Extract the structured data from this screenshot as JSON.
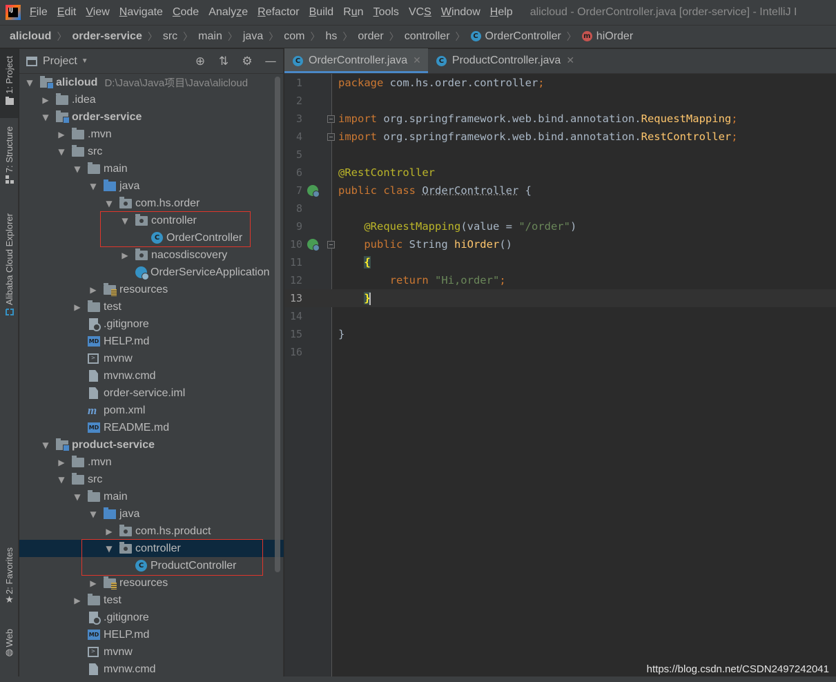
{
  "window": {
    "title": "alicloud - OrderController.java [order-service] - IntelliJ I"
  },
  "menu": [
    {
      "pre": "",
      "ul": "F",
      "post": "ile"
    },
    {
      "pre": "",
      "ul": "E",
      "post": "dit"
    },
    {
      "pre": "",
      "ul": "V",
      "post": "iew"
    },
    {
      "pre": "",
      "ul": "N",
      "post": "avigate"
    },
    {
      "pre": "",
      "ul": "C",
      "post": "ode"
    },
    {
      "pre": "Analy",
      "ul": "z",
      "post": "e"
    },
    {
      "pre": "",
      "ul": "R",
      "post": "efactor"
    },
    {
      "pre": "",
      "ul": "B",
      "post": "uild"
    },
    {
      "pre": "R",
      "ul": "u",
      "post": "n"
    },
    {
      "pre": "",
      "ul": "T",
      "post": "ools"
    },
    {
      "pre": "VC",
      "ul": "S",
      "post": ""
    },
    {
      "pre": "",
      "ul": "W",
      "post": "indow"
    },
    {
      "pre": "",
      "ul": "H",
      "post": "elp"
    }
  ],
  "breadcrumb": {
    "items": [
      "alicloud",
      "order-service",
      "src",
      "main",
      "java",
      "com",
      "hs",
      "order",
      "controller"
    ],
    "class_label": "OrderController",
    "method_label": "hiOrder"
  },
  "toolstrip": {
    "project": "1: Project",
    "structure": "7: Structure",
    "cloud": "Alibaba Cloud Explorer",
    "favorites": "2: Favorites",
    "web": "Web"
  },
  "project_panel": {
    "title": "Project"
  },
  "tree": [
    {
      "label": "alicloud",
      "path": "D:\\Java\\Java项目\\Java\\alicloud",
      "depth": 0,
      "arrow": "down",
      "icon": "module",
      "bold": true
    },
    {
      "label": ".idea",
      "depth": 1,
      "arrow": "right",
      "icon": "folder"
    },
    {
      "label": "order-service",
      "depth": 1,
      "arrow": "down",
      "icon": "module",
      "bold": true
    },
    {
      "label": ".mvn",
      "depth": 2,
      "arrow": "right",
      "icon": "folder"
    },
    {
      "label": "src",
      "depth": 2,
      "arrow": "down",
      "icon": "folder"
    },
    {
      "label": "main",
      "depth": 3,
      "arrow": "down",
      "icon": "folder"
    },
    {
      "label": "java",
      "depth": 4,
      "arrow": "down",
      "icon": "folder-blue"
    },
    {
      "label": "com.hs.order",
      "depth": 5,
      "arrow": "down",
      "icon": "package"
    },
    {
      "label": "controller",
      "depth": 6,
      "arrow": "down",
      "icon": "package"
    },
    {
      "label": "OrderController",
      "depth": 7,
      "arrow": "none",
      "icon": "class"
    },
    {
      "label": "nacosdiscovery",
      "depth": 6,
      "arrow": "right",
      "icon": "package"
    },
    {
      "label": "OrderServiceApplication",
      "depth": 6,
      "arrow": "none",
      "icon": "appclass"
    },
    {
      "label": "resources",
      "depth": 4,
      "arrow": "right",
      "icon": "resources"
    },
    {
      "label": "test",
      "depth": 3,
      "arrow": "right",
      "icon": "folder"
    },
    {
      "label": ".gitignore",
      "depth": 3,
      "arrow": "none",
      "icon": "git"
    },
    {
      "label": "HELP.md",
      "depth": 3,
      "arrow": "none",
      "icon": "md"
    },
    {
      "label": "mvnw",
      "depth": 3,
      "arrow": "none",
      "icon": "term"
    },
    {
      "label": "mvnw.cmd",
      "depth": 3,
      "arrow": "none",
      "icon": "file"
    },
    {
      "label": "order-service.iml",
      "depth": 3,
      "arrow": "none",
      "icon": "file"
    },
    {
      "label": "pom.xml",
      "depth": 3,
      "arrow": "none",
      "icon": "maven"
    },
    {
      "label": "README.md",
      "depth": 3,
      "arrow": "none",
      "icon": "md"
    },
    {
      "label": "product-service",
      "depth": 1,
      "arrow": "down",
      "icon": "module",
      "bold": true
    },
    {
      "label": ".mvn",
      "depth": 2,
      "arrow": "right",
      "icon": "folder"
    },
    {
      "label": "src",
      "depth": 2,
      "arrow": "down",
      "icon": "folder"
    },
    {
      "label": "main",
      "depth": 3,
      "arrow": "down",
      "icon": "folder"
    },
    {
      "label": "java",
      "depth": 4,
      "arrow": "down",
      "icon": "folder-blue"
    },
    {
      "label": "com.hs.product",
      "depth": 5,
      "arrow": "right",
      "icon": "package"
    },
    {
      "label": "controller",
      "depth": 5,
      "arrow": "down",
      "icon": "package",
      "selected": true
    },
    {
      "label": "ProductController",
      "depth": 6,
      "arrow": "none",
      "icon": "class"
    },
    {
      "label": "resources",
      "depth": 4,
      "arrow": "right",
      "icon": "resources"
    },
    {
      "label": "test",
      "depth": 3,
      "arrow": "right",
      "icon": "folder"
    },
    {
      "label": ".gitignore",
      "depth": 3,
      "arrow": "none",
      "icon": "git"
    },
    {
      "label": "HELP.md",
      "depth": 3,
      "arrow": "none",
      "icon": "md"
    },
    {
      "label": "mvnw",
      "depth": 3,
      "arrow": "none",
      "icon": "term"
    },
    {
      "label": "mvnw.cmd",
      "depth": 3,
      "arrow": "none",
      "icon": "file"
    }
  ],
  "tabs": [
    {
      "label": "OrderController.java",
      "active": true
    },
    {
      "label": "ProductController.java",
      "active": false
    }
  ],
  "code_lines": [
    [
      {
        "t": "kw",
        "s": "package "
      },
      {
        "t": "",
        "s": "com.hs.order.controller"
      },
      {
        "t": "kw",
        "s": ";"
      }
    ],
    [],
    [
      {
        "t": "kw",
        "s": "import "
      },
      {
        "t": "",
        "s": "org.springframework.web.bind.annotation."
      },
      {
        "t": "fn",
        "s": "RequestMapping"
      },
      {
        "t": "kw",
        "s": ";"
      }
    ],
    [
      {
        "t": "kw",
        "s": "import "
      },
      {
        "t": "",
        "s": "org.springframework.web.bind.annotation."
      },
      {
        "t": "fn",
        "s": "RestController"
      },
      {
        "t": "kw",
        "s": ";"
      }
    ],
    [],
    [
      {
        "t": "ann",
        "s": "@RestController"
      }
    ],
    [
      {
        "t": "kw",
        "s": "public class "
      },
      {
        "t": "cls-u",
        "s": "OrderController"
      },
      {
        "t": "",
        "s": " {"
      }
    ],
    [],
    [
      {
        "t": "",
        "s": "    "
      },
      {
        "t": "ann",
        "s": "@RequestMapping"
      },
      {
        "t": "",
        "s": "(value = "
      },
      {
        "t": "str",
        "s": "\"/order\""
      },
      {
        "t": "",
        "s": ")"
      }
    ],
    [
      {
        "t": "",
        "s": "    "
      },
      {
        "t": "kw",
        "s": "public "
      },
      {
        "t": "",
        "s": "String "
      },
      {
        "t": "fn",
        "s": "hiOrder"
      },
      {
        "t": "",
        "s": "()"
      }
    ],
    [
      {
        "t": "",
        "s": "    "
      },
      {
        "t": "brace-hl",
        "s": "{"
      }
    ],
    [
      {
        "t": "",
        "s": "        "
      },
      {
        "t": "kw",
        "s": "return "
      },
      {
        "t": "str",
        "s": "\"Hi,order\""
      },
      {
        "t": "kw",
        "s": ";"
      }
    ],
    [
      {
        "t": "",
        "s": "    "
      },
      {
        "t": "brace-hl",
        "s": "}"
      }
    ],
    [],
    [
      {
        "t": "",
        "s": "}"
      }
    ],
    []
  ],
  "current_line": 13,
  "gutter_markers": {
    "run_lines": [
      7,
      10
    ],
    "fold_lines": [
      3,
      4,
      10,
      13
    ]
  },
  "watermark": "https://blog.csdn.net/CSDN2497242041"
}
